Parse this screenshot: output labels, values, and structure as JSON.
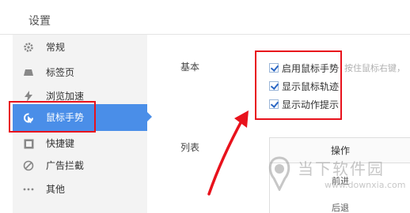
{
  "header": {
    "title": "设置"
  },
  "sidebar": {
    "items": [
      {
        "label": "常规",
        "icon": "gear-icon"
      },
      {
        "label": "标签页",
        "icon": "tab-icon"
      },
      {
        "label": "浏览加速",
        "icon": "lightning-icon"
      },
      {
        "label": "鼠标手势",
        "icon": "mouse-gesture-icon",
        "active": true
      },
      {
        "label": "快捷键",
        "icon": "keyboard-icon"
      },
      {
        "label": "广告拦截",
        "icon": "block-icon"
      },
      {
        "label": "其他",
        "icon": "more-icon"
      }
    ]
  },
  "basic": {
    "label": "基本",
    "options": [
      {
        "label": "启用鼠标手势",
        "checked": true
      },
      {
        "label": "显示鼠标轨迹",
        "checked": true
      },
      {
        "label": "显示动作提示",
        "checked": true
      }
    ],
    "hint": "按住鼠标右键，"
  },
  "list": {
    "label": "列表",
    "header": "操作",
    "rows": [
      "前进",
      "后退"
    ]
  },
  "watermark": {
    "text": "当下软件园",
    "url": "www.downxia.com"
  },
  "colors": {
    "accent": "#4a8ee8",
    "highlight": "#e8121c",
    "sidebar_bg": "#f3f3f3"
  }
}
